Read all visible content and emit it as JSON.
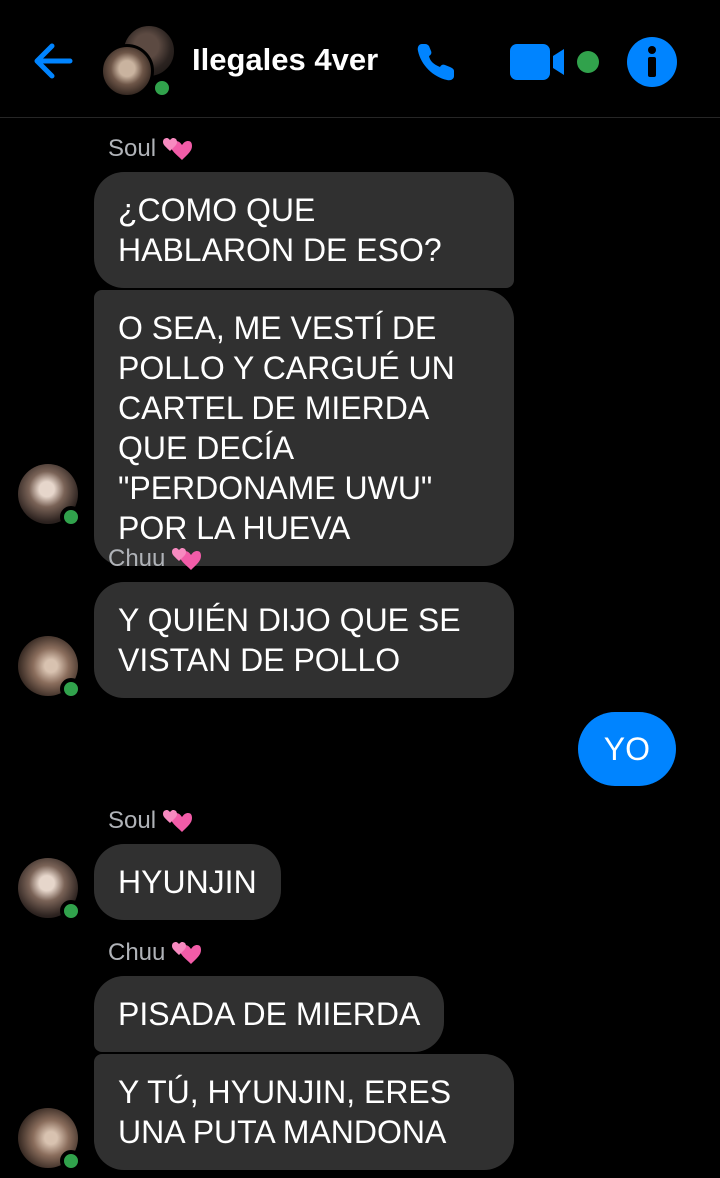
{
  "header": {
    "title": "Ilegales 4ver",
    "back_icon": "arrow-left-icon",
    "call_icon": "phone-icon",
    "video_icon": "video-camera-icon",
    "info_icon": "info-icon",
    "accent_color": "#0084ff",
    "online_color": "#31a24c"
  },
  "messages": [
    {
      "sender": "Soul",
      "sender_icon": "two-hearts-icon",
      "bubbles": [
        "¿COMO QUE HABLARON DE ESO?",
        "O SEA, ME VESTÍ DE POLLO Y CARGUÉ UN CARTEL DE MIERDA QUE DECÍA \"PERDONAME UWU\" POR LA HUEVA"
      ]
    },
    {
      "sender": "Chuu",
      "sender_icon": "two-hearts-icon",
      "bubbles": [
        "Y QUIÉN DIJO QUE SE VISTAN DE POLLO"
      ]
    },
    {
      "sender": "me",
      "bubbles": [
        "YO"
      ]
    },
    {
      "sender": "Soul",
      "sender_icon": "two-hearts-icon",
      "bubbles": [
        "HYUNJIN"
      ]
    },
    {
      "sender": "Chuu",
      "sender_icon": "two-hearts-icon",
      "bubbles": [
        "PISADA DE MIERDA",
        "Y TÚ, HYUNJIN, ERES UNA PUTA MANDONA"
      ]
    }
  ]
}
